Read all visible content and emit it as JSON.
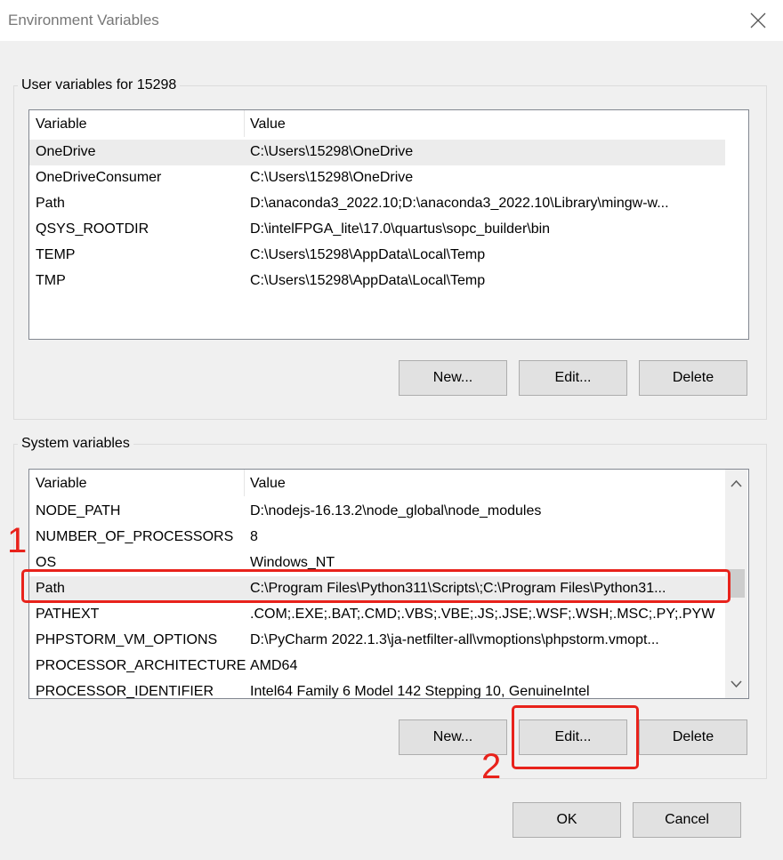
{
  "window": {
    "title": "Environment Variables"
  },
  "user_vars": {
    "group_label": "User variables for 15298",
    "headers": {
      "variable": "Variable",
      "value": "Value"
    },
    "rows": [
      {
        "variable": "OneDrive",
        "value": "C:\\Users\\15298\\OneDrive"
      },
      {
        "variable": "OneDriveConsumer",
        "value": "C:\\Users\\15298\\OneDrive"
      },
      {
        "variable": "Path",
        "value": "D:\\anaconda3_2022.10;D:\\anaconda3_2022.10\\Library\\mingw-w..."
      },
      {
        "variable": "QSYS_ROOTDIR",
        "value": "D:\\intelFPGA_lite\\17.0\\quartus\\sopc_builder\\bin"
      },
      {
        "variable": "TEMP",
        "value": "C:\\Users\\15298\\AppData\\Local\\Temp"
      },
      {
        "variable": "TMP",
        "value": "C:\\Users\\15298\\AppData\\Local\\Temp"
      }
    ],
    "buttons": {
      "new": "New...",
      "edit": "Edit...",
      "delete": "Delete"
    }
  },
  "system_vars": {
    "group_label": "System variables",
    "headers": {
      "variable": "Variable",
      "value": "Value"
    },
    "rows": [
      {
        "variable": "NODE_PATH",
        "value": "D:\\nodejs-16.13.2\\node_global\\node_modules"
      },
      {
        "variable": "NUMBER_OF_PROCESSORS",
        "value": "8"
      },
      {
        "variable": "OS",
        "value": "Windows_NT"
      },
      {
        "variable": "Path",
        "value": "C:\\Program Files\\Python311\\Scripts\\;C:\\Program Files\\Python31..."
      },
      {
        "variable": "PATHEXT",
        "value": ".COM;.EXE;.BAT;.CMD;.VBS;.VBE;.JS;.JSE;.WSF;.WSH;.MSC;.PY;.PYW"
      },
      {
        "variable": "PHPSTORM_VM_OPTIONS",
        "value": "D:\\PyCharm 2022.1.3\\ja-netfilter-all\\vmoptions\\phpstorm.vmopt..."
      },
      {
        "variable": "PROCESSOR_ARCHITECTURE",
        "value": "AMD64"
      },
      {
        "variable": "PROCESSOR_IDENTIFIER",
        "value": "Intel64 Family 6 Model 142 Stepping 10, GenuineIntel"
      }
    ],
    "buttons": {
      "new": "New...",
      "edit": "Edit...",
      "delete": "Delete"
    }
  },
  "dialog_buttons": {
    "ok": "OK",
    "cancel": "Cancel"
  },
  "annotations": {
    "step1": "1",
    "step2": "2",
    "color": "#e8221b"
  },
  "icons": {
    "close": "close-icon",
    "scroll_up": "chevron-up-icon",
    "scroll_down": "chevron-down-icon"
  }
}
